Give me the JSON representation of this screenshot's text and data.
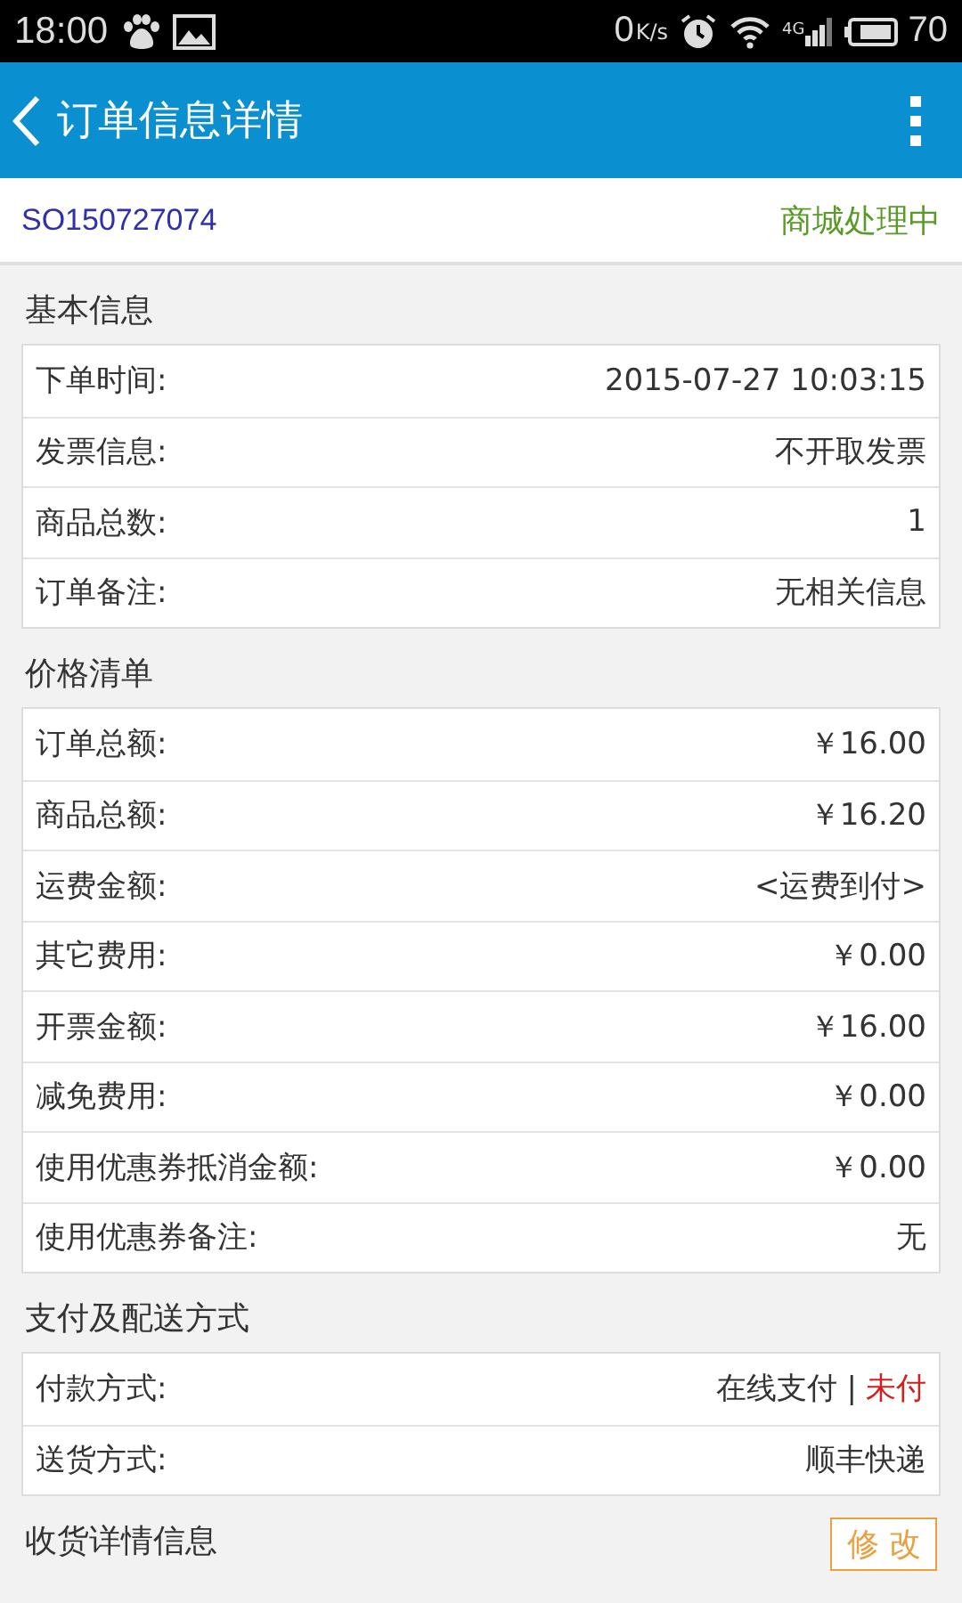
{
  "status_bar": {
    "time": "18:00",
    "speed": "0",
    "speed_unit": "K/s",
    "network": "4G",
    "battery": "70"
  },
  "app_bar": {
    "title": "订单信息详情"
  },
  "order": {
    "number": "SO150727074",
    "status": "商城处理中"
  },
  "sections": [
    {
      "title": "基本信息",
      "rows": [
        {
          "label": "下单时间:",
          "value": "2015-07-27 10:03:15"
        },
        {
          "label": "发票信息:",
          "value": "不开取发票"
        },
        {
          "label": "商品总数:",
          "value": "1"
        },
        {
          "label": "订单备注:",
          "value": "无相关信息"
        }
      ]
    },
    {
      "title": "价格清单",
      "rows": [
        {
          "label": "订单总额:",
          "value": "￥16.00"
        },
        {
          "label": "商品总额:",
          "value": "￥16.20"
        },
        {
          "label": "运费金额:",
          "value": "<运费到付>"
        },
        {
          "label": "其它费用:",
          "value": "￥0.00"
        },
        {
          "label": "开票金额:",
          "value": "￥16.00"
        },
        {
          "label": "减免费用:",
          "value": "￥0.00"
        },
        {
          "label": "使用优惠券抵消金额:",
          "value": "￥0.00"
        },
        {
          "label": "使用优惠券备注:",
          "value": "无"
        }
      ]
    },
    {
      "title": "支付及配送方式",
      "rows": [
        {
          "label": "付款方式:",
          "value": "在线支付 |",
          "note": "未付"
        },
        {
          "label": "送货方式:",
          "value": "顺丰快递"
        }
      ]
    },
    {
      "title": "收货详情信息",
      "action": "修 改"
    }
  ]
}
